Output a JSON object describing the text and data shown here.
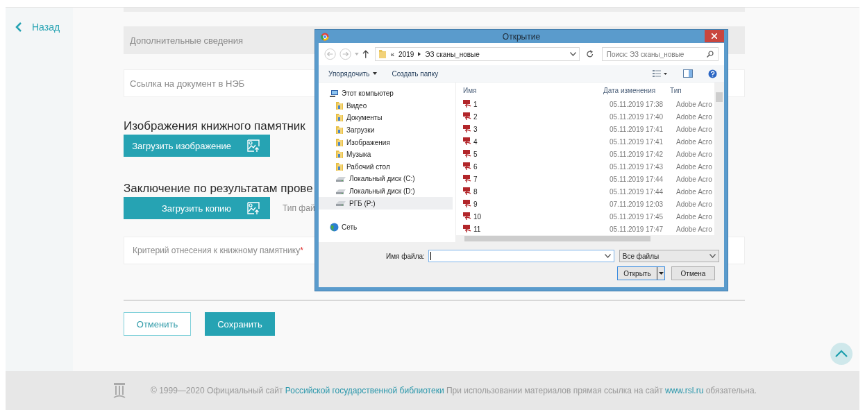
{
  "sidebar": {
    "back_link": "Назад"
  },
  "form": {
    "fields": [
      {
        "kind": "disabled",
        "placeholder": "Дополнительные сведения"
      },
      {
        "kind": "input",
        "placeholder": "Ссылка на документ в НЭБ"
      }
    ],
    "uploads": [
      {
        "heading": "Изображения книжного памятник",
        "button": "Загрузить изображение"
      },
      {
        "heading": "Заключение по результатам прове",
        "button": "Загрузить копию",
        "note": "Тип фай"
      }
    ],
    "criterion": {
      "placeholder": "Критерий отнесения к книжному памятнику",
      "required_mark": "*"
    },
    "buttons": [
      {
        "label": "Отменить",
        "kind": "secondary"
      },
      {
        "label": "Сохранить",
        "kind": "primary"
      }
    ]
  },
  "dialog": {
    "title": "Открытие",
    "address": {
      "overflow": "«",
      "path": [
        "2019",
        "ЭЗ сканы_новые"
      ]
    },
    "search": {
      "placeholder": "Поиск: ЭЗ сканы_новые"
    },
    "toolbar": {
      "organize": "Упорядочить",
      "new_folder": "Создать папку"
    },
    "nav": [
      {
        "label": "Этот компьютер",
        "kind": "computer",
        "selected": false,
        "children": [
          {
            "label": "Видео",
            "kind": "folder",
            "selected": false
          },
          {
            "label": "Документы",
            "kind": "folder",
            "selected": false
          },
          {
            "label": "Загрузки",
            "kind": "folder",
            "selected": false
          },
          {
            "label": "Изображения",
            "kind": "folder",
            "selected": false
          },
          {
            "label": "Музыка",
            "kind": "folder",
            "selected": false
          },
          {
            "label": "Рабочий стол",
            "kind": "folder",
            "selected": false
          },
          {
            "label": "Локальный диск (C:)",
            "kind": "drive",
            "selected": false
          },
          {
            "label": "Локальный диск (D:)",
            "kind": "drive",
            "selected": false
          },
          {
            "label": "РГБ (P:)",
            "kind": "drive",
            "selected": true
          }
        ]
      },
      {
        "label": "Сеть",
        "kind": "network",
        "selected": false
      }
    ],
    "columns": [
      "Имя",
      "Дата изменения",
      "Тип"
    ],
    "files": [
      {
        "name": "1",
        "date": "05.11.2019 17:38",
        "type": "Adobe Acro"
      },
      {
        "name": "2",
        "date": "05.11.2019 17:40",
        "type": "Adobe Acro"
      },
      {
        "name": "3",
        "date": "05.11.2019 17:41",
        "type": "Adobe Acro"
      },
      {
        "name": "4",
        "date": "05.11.2019 17:41",
        "type": "Adobe Acro"
      },
      {
        "name": "5",
        "date": "05.11.2019 17:42",
        "type": "Adobe Acro"
      },
      {
        "name": "6",
        "date": "05.11.2019 17:43",
        "type": "Adobe Acro"
      },
      {
        "name": "7",
        "date": "05.11.2019 17:44",
        "type": "Adobe Acro"
      },
      {
        "name": "8",
        "date": "05.11.2019 17:44",
        "type": "Adobe Acro"
      },
      {
        "name": "9",
        "date": "07.11.2019 12:03",
        "type": "Adobe Acro"
      },
      {
        "name": "10",
        "date": "05.11.2019 17:45",
        "type": "Adobe Acro"
      },
      {
        "name": "11",
        "date": "05.11.2019 17:47",
        "type": "Adobe Acro"
      }
    ],
    "filename": {
      "label": "Имя файла:"
    },
    "filter": "Все файлы",
    "buttons": [
      {
        "label": "Открыть",
        "kind": "split"
      },
      {
        "label": "Отмена",
        "kind": "plain"
      }
    ]
  },
  "footer": {
    "parts": [
      {
        "text": "© 1999—2020 Официальный сайт ",
        "link": false
      },
      {
        "text": "Российской государственной библиотеки",
        "link": true
      },
      {
        "text": " При использовании материалов прямая ссылка на сайт ",
        "link": false
      },
      {
        "text": "www.rsl.ru",
        "link": true
      },
      {
        "text": " обязательна.",
        "link": false
      }
    ]
  }
}
